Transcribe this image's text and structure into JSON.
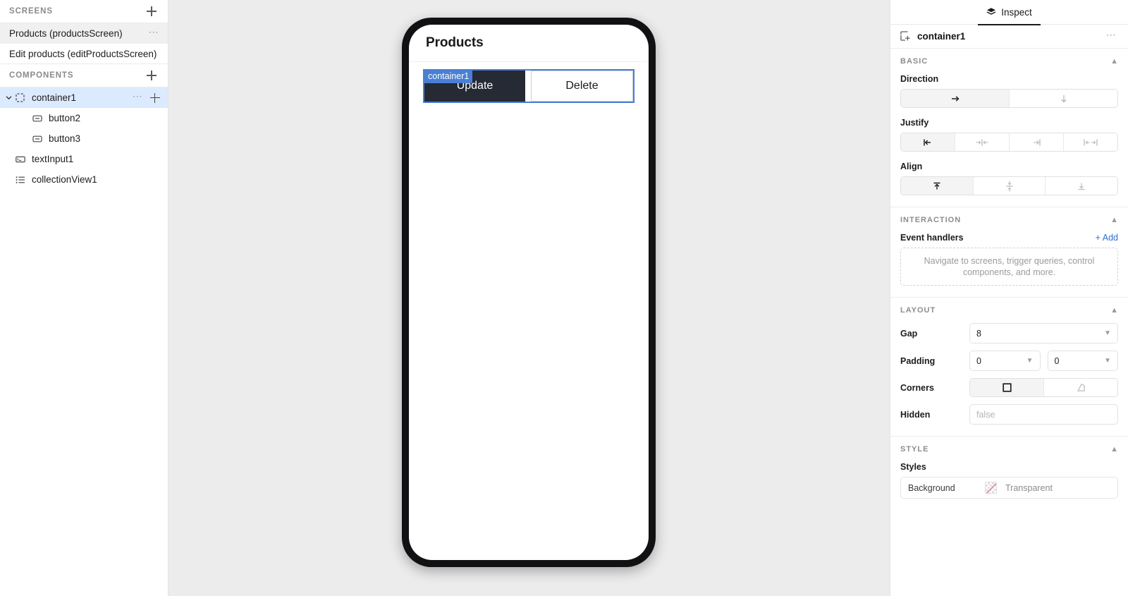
{
  "sidebar": {
    "screens": {
      "title": "SCREENS",
      "add_icon": "plus-icon",
      "items": [
        {
          "label": "Products (productsScreen)",
          "selected": true,
          "menu_icon": "ellipsis-icon"
        },
        {
          "label": "Edit products (editProductsScreen)",
          "selected": false
        }
      ]
    },
    "components": {
      "title": "COMPONENTS",
      "add_icon": "plus-icon",
      "items": [
        {
          "label": "container1",
          "icon": "dashed-square-icon",
          "selected": true,
          "expanded": true,
          "depth": 0,
          "menu_icon": "ellipsis-icon",
          "add_icon": "plus-icon"
        },
        {
          "label": "button2",
          "icon": "button-icon",
          "selected": false,
          "depth": 1
        },
        {
          "label": "button3",
          "icon": "button-icon",
          "selected": false,
          "depth": 1
        },
        {
          "label": "textInput1",
          "icon": "text-input-icon",
          "selected": false,
          "depth": 0
        },
        {
          "label": "collectionView1",
          "icon": "list-icon",
          "selected": false,
          "depth": 0
        }
      ]
    }
  },
  "canvas": {
    "phone": {
      "header_title": "Products",
      "selection_badge": "container1",
      "buttons": [
        {
          "label": "Update",
          "variant": "primary"
        },
        {
          "label": "Delete",
          "variant": "secondary"
        }
      ]
    }
  },
  "inspector": {
    "tab": {
      "label": "Inspect",
      "icon": "layers-icon"
    },
    "header": {
      "name": "container1",
      "icon": "add-container-icon",
      "menu_icon": "ellipsis-icon"
    },
    "basic": {
      "title": "BASIC",
      "collapse_icon": "chevron-up-icon",
      "direction": {
        "label": "Direction",
        "options": [
          {
            "icon": "arrow-right-icon",
            "selected": true
          },
          {
            "icon": "arrow-down-icon",
            "selected": false
          }
        ]
      },
      "justify": {
        "label": "Justify",
        "options": [
          {
            "icon": "justify-start-icon",
            "selected": true
          },
          {
            "icon": "justify-center-icon",
            "selected": false
          },
          {
            "icon": "justify-end-icon",
            "selected": false
          },
          {
            "icon": "justify-space-between-icon",
            "selected": false
          }
        ]
      },
      "align": {
        "label": "Align",
        "options": [
          {
            "icon": "align-top-icon",
            "selected": true
          },
          {
            "icon": "align-middle-icon",
            "selected": false
          },
          {
            "icon": "align-bottom-icon",
            "selected": false
          }
        ]
      }
    },
    "interaction": {
      "title": "INTERACTION",
      "collapse_icon": "chevron-up-icon",
      "event_handlers_label": "Event handlers",
      "add_label": "+ Add",
      "empty_text": "Navigate to screens, trigger queries, control components, and more."
    },
    "layout": {
      "title": "LAYOUT",
      "collapse_icon": "chevron-up-icon",
      "gap": {
        "label": "Gap",
        "value": "8"
      },
      "padding": {
        "label": "Padding",
        "value_x": "0",
        "value_y": "0"
      },
      "corners": {
        "label": "Corners",
        "options": [
          {
            "icon": "square-corner-icon",
            "selected": true
          },
          {
            "icon": "rounded-corner-icon",
            "selected": false
          }
        ]
      },
      "hidden": {
        "label": "Hidden",
        "placeholder": "false",
        "value": ""
      }
    },
    "style": {
      "title": "STYLE",
      "collapse_icon": "chevron-up-icon",
      "styles_label": "Styles",
      "background": {
        "key": "Background",
        "swatch_icon": "transparent-swatch-icon",
        "value": "Transparent"
      }
    }
  },
  "colors": {
    "accent_blue": "#2f6fd0",
    "selection_blue": "#4a80d4",
    "tree_selected": "#dbeafe",
    "canvas_bg": "#ececec",
    "btn_primary_bg": "#252a35"
  }
}
